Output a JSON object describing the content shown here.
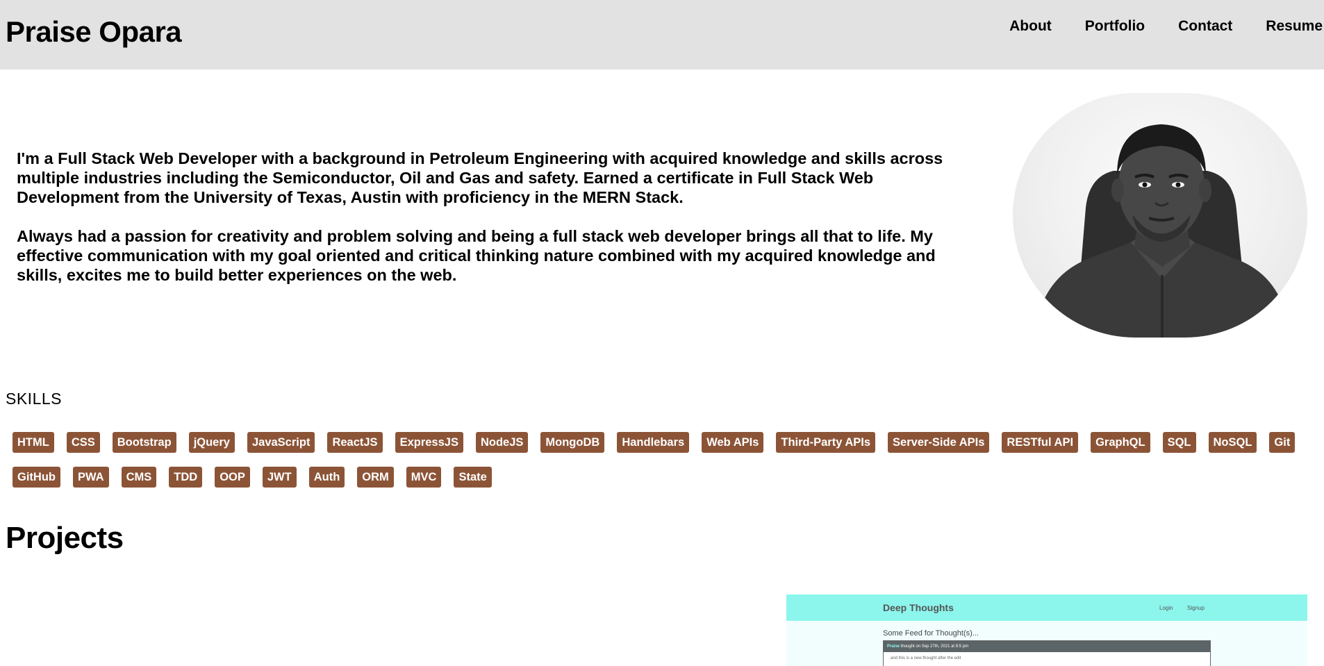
{
  "header": {
    "brand": "Praise Opara",
    "nav": [
      {
        "label": "About"
      },
      {
        "label": "Portfolio"
      },
      {
        "label": "Contact"
      },
      {
        "label": "Resume"
      }
    ],
    "background": "#e2e2e2"
  },
  "about": {
    "paragraphs": [
      "I'm a Full Stack Web Developer with a background in Petroleum Engineering with acquired knowledge and skills across multiple industries including the Semiconductor, Oil and Gas and safety. Earned a certificate in Full Stack Web Development from the University of Texas, Austin with proficiency in the MERN Stack.",
      "Always had a passion for creativity and problem solving and being a full stack web developer brings all that to life. My effective communication with my goal oriented and critical thinking nature combined with my acquired knowledge and skills, excites me to build better experiences on the web."
    ],
    "photo_icon": "profile-photo"
  },
  "skills": {
    "title": "SKILLS",
    "badge_color": "#8c5437",
    "items": [
      "HTML",
      "CSS",
      "Bootstrap",
      "jQuery",
      "JavaScript",
      "ReactJS",
      "ExpressJS",
      "NodeJS",
      "MongoDB",
      "Handlebars",
      "Web APIs",
      "Third-Party APIs",
      "Server-Side APIs",
      "RESTful API",
      "GraphQL",
      "SQL",
      "NoSQL",
      "Git",
      "GitHub",
      "PWA",
      "CMS",
      "TDD",
      "OOP",
      "JWT",
      "Auth",
      "ORM",
      "MVC",
      "State"
    ]
  },
  "projects": {
    "title": "Projects",
    "preview": {
      "app_title": "Deep Thoughts",
      "login": "Login",
      "signup": "Signup",
      "feed_title": "Some Feed for Thought(s)...",
      "card_author": "Praise",
      "card_meta": "thought on Sep 27th, 2021 at 8:5 pm",
      "card_text": "and this is a new thought after the edit",
      "accent_color": "#8cf5ec"
    }
  }
}
